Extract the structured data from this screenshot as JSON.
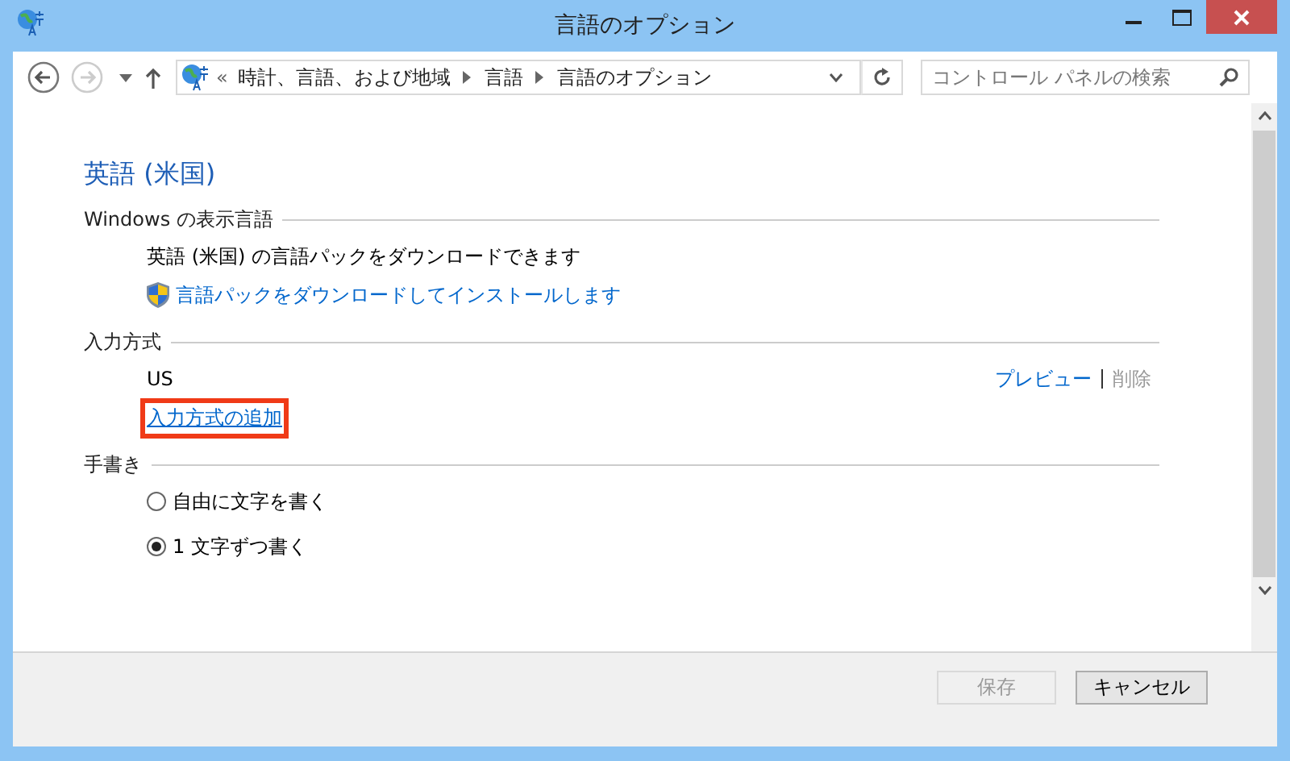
{
  "window": {
    "title": "言語のオプション"
  },
  "nav": {
    "overflow": "«",
    "breadcrumb": [
      "時計、言語、および地域",
      "言語",
      "言語のオプション"
    ],
    "search": {
      "placeholder": "コントロール パネルの検索"
    }
  },
  "content": {
    "heading": "英語 (米国)",
    "sections": [
      {
        "title": "Windows の表示言語",
        "items": [
          {
            "kind": "text",
            "text": "英語 (米国) の言語パックをダウンロードできます"
          },
          {
            "kind": "shield_link",
            "text": "言語パックをダウンロードしてインストールします"
          }
        ]
      },
      {
        "title": "入力方式",
        "items": [
          {
            "kind": "method",
            "text": "US",
            "actions": [
              {
                "label": "プレビュー",
                "disabled": false
              },
              {
                "label": "削除",
                "disabled": true
              }
            ]
          },
          {
            "kind": "link",
            "text": "入力方式の追加",
            "highlighted": true
          }
        ]
      },
      {
        "title": "手書き",
        "items": [
          {
            "kind": "radio",
            "text": "自由に文字を書く",
            "selected": false
          },
          {
            "kind": "radio",
            "text": "1 文字ずつ書く",
            "selected": true
          }
        ]
      }
    ]
  },
  "buttons": [
    {
      "label": "保存",
      "disabled": true
    },
    {
      "label": "キャンセル",
      "disabled": false
    }
  ]
}
